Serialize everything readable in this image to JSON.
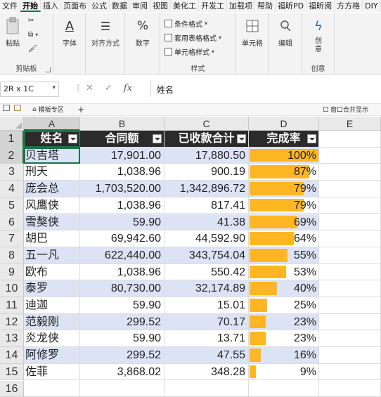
{
  "ribbon_tabs": [
    "文件",
    "开始",
    "插入",
    "页面布",
    "公式",
    "数据",
    "审阅",
    "视图",
    "美化工",
    "开发工",
    "加载项",
    "帮助",
    "福昕PD",
    "福昕阅",
    "方方格",
    "DIY"
  ],
  "active_tab": "开始",
  "ribbon": {
    "clipboard": {
      "paste": "粘贴",
      "label": "剪贴板"
    },
    "font": {
      "label": "字体"
    },
    "align": {
      "label": "对齐方式"
    },
    "number": {
      "label": "数字"
    },
    "styles": {
      "conditional": "条件格式",
      "table_fmt": "套用表格格式",
      "cell_style": "单元格样式",
      "label": "样式"
    },
    "cells": {
      "label": "单元格"
    },
    "edit": {
      "label": "编辑"
    },
    "idea": {
      "btn": "创意",
      "label": "创意"
    }
  },
  "formula_bar": {
    "name_box": "2R x 1C",
    "content": "姓名"
  },
  "doc_bar": {
    "template_tab": "模板专区",
    "right_label": "窗口合并显示"
  },
  "columns": [
    "A",
    "B",
    "C",
    "D",
    "E"
  ],
  "rows": [
    "1",
    "2",
    "3",
    "4",
    "5",
    "6",
    "7",
    "8",
    "9",
    "10",
    "11",
    "12",
    "13",
    "14",
    "15",
    "16"
  ],
  "header": {
    "name": "姓名",
    "contract": "合同额",
    "received": "已收款合计",
    "rate": "完成率"
  },
  "records": [
    {
      "name": "贝吉塔",
      "contract": "17,901.00",
      "received": "17,880.50",
      "rate": "100%",
      "pct": 100
    },
    {
      "name": "刑天",
      "contract": "1,038.96",
      "received": "900.19",
      "rate": "87%",
      "pct": 87
    },
    {
      "name": "庞会总",
      "contract": "1,703,520.00",
      "received": "1,342,896.72",
      "rate": "79%",
      "pct": 79
    },
    {
      "name": "风鹰侠",
      "contract": "1,038.96",
      "received": "817.41",
      "rate": "79%",
      "pct": 79
    },
    {
      "name": "雪獒侠",
      "contract": "59.90",
      "received": "41.38",
      "rate": "69%",
      "pct": 69
    },
    {
      "name": "胡巴",
      "contract": "69,942.60",
      "received": "44,592.90",
      "rate": "64%",
      "pct": 64
    },
    {
      "name": "五一凡",
      "contract": "622,440.00",
      "received": "343,754.04",
      "rate": "55%",
      "pct": 55
    },
    {
      "name": "欧布",
      "contract": "1,038.96",
      "received": "550.42",
      "rate": "53%",
      "pct": 53
    },
    {
      "name": "泰罗",
      "contract": "80,730.00",
      "received": "32,174.89",
      "rate": "40%",
      "pct": 40
    },
    {
      "name": "迪迦",
      "contract": "59.90",
      "received": "15.01",
      "rate": "25%",
      "pct": 25
    },
    {
      "name": "范毅刚",
      "contract": "299.52",
      "received": "70.17",
      "rate": "23%",
      "pct": 23
    },
    {
      "name": "炎龙侠",
      "contract": "59.90",
      "received": "13.71",
      "rate": "23%",
      "pct": 23
    },
    {
      "name": "阿修罗",
      "contract": "299.52",
      "received": "47.55",
      "rate": "16%",
      "pct": 16
    },
    {
      "name": "佐菲",
      "contract": "3,868.02",
      "received": "348.28",
      "rate": "9%",
      "pct": 9
    }
  ],
  "colors": {
    "accent": "#1e7145",
    "band": "#dce3f5",
    "header_bg": "#2b2b2b",
    "databar": "#ffb622"
  }
}
